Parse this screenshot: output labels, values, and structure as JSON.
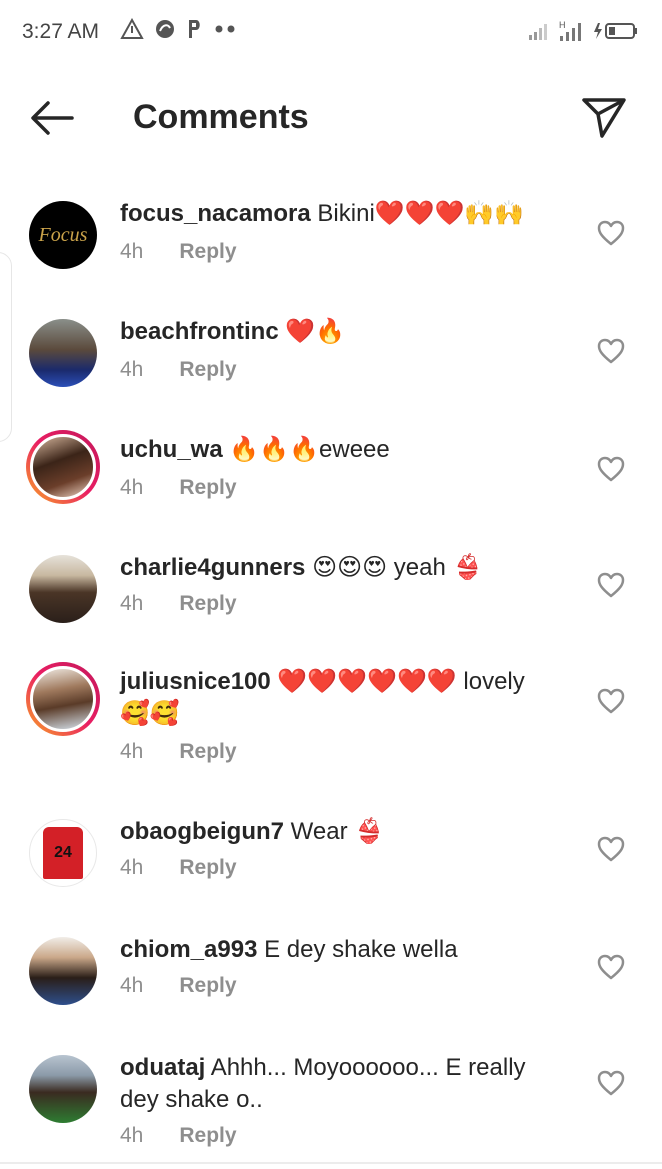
{
  "status_bar": {
    "time": "3:27 AM",
    "left_icons": [
      "triangle-icon",
      "shark-icon",
      "p-icon",
      "more-dots-icon"
    ],
    "right_icons": [
      "signal-icon",
      "signal-h-icon",
      "battery-charging-icon"
    ]
  },
  "header": {
    "title": "Comments",
    "back_icon": "arrow-left-icon",
    "share_icon": "send-icon"
  },
  "comments": [
    {
      "username": "focus_nacamora",
      "text": "Bikini❤️❤️❤️🙌🙌",
      "time": "4h",
      "reply_label": "Reply",
      "avatar_text": "Focus",
      "story_ring": false
    },
    {
      "username": "beachfrontinc",
      "text": "❤️🔥",
      "time": "4h",
      "reply_label": "Reply",
      "story_ring": false
    },
    {
      "username": "uchu_wa",
      "text": "🔥🔥🔥eweee",
      "time": "4h",
      "reply_label": "Reply",
      "story_ring": true
    },
    {
      "username": "charlie4gunners",
      "text": "😍😍😍 yeah 👙",
      "time": "4h",
      "reply_label": "Reply",
      "story_ring": false
    },
    {
      "username": "juliusnice100",
      "text": "❤️❤️❤️❤️❤️❤️ lovely 🥰🥰",
      "time": "4h",
      "reply_label": "Reply",
      "story_ring": true
    },
    {
      "username": "obaogbeigun7",
      "text": "Wear 👙",
      "time": "4h",
      "reply_label": "Reply",
      "avatar_text": "24",
      "story_ring": false
    },
    {
      "username": "chiom_a993",
      "text": "E dey shake wella",
      "time": "4h",
      "reply_label": "Reply",
      "story_ring": false
    },
    {
      "username": "oduataj",
      "text": "Ahhh... Moyoooooo... E really dey shake o..",
      "time": "4h",
      "reply_label": "Reply",
      "story_ring": false
    }
  ],
  "colors": {
    "text": "#262626",
    "meta": "#8e8e8e",
    "ring_start": "#f9a825",
    "ring_end": "#c2185b",
    "like_outline": "#8e8e8e"
  }
}
